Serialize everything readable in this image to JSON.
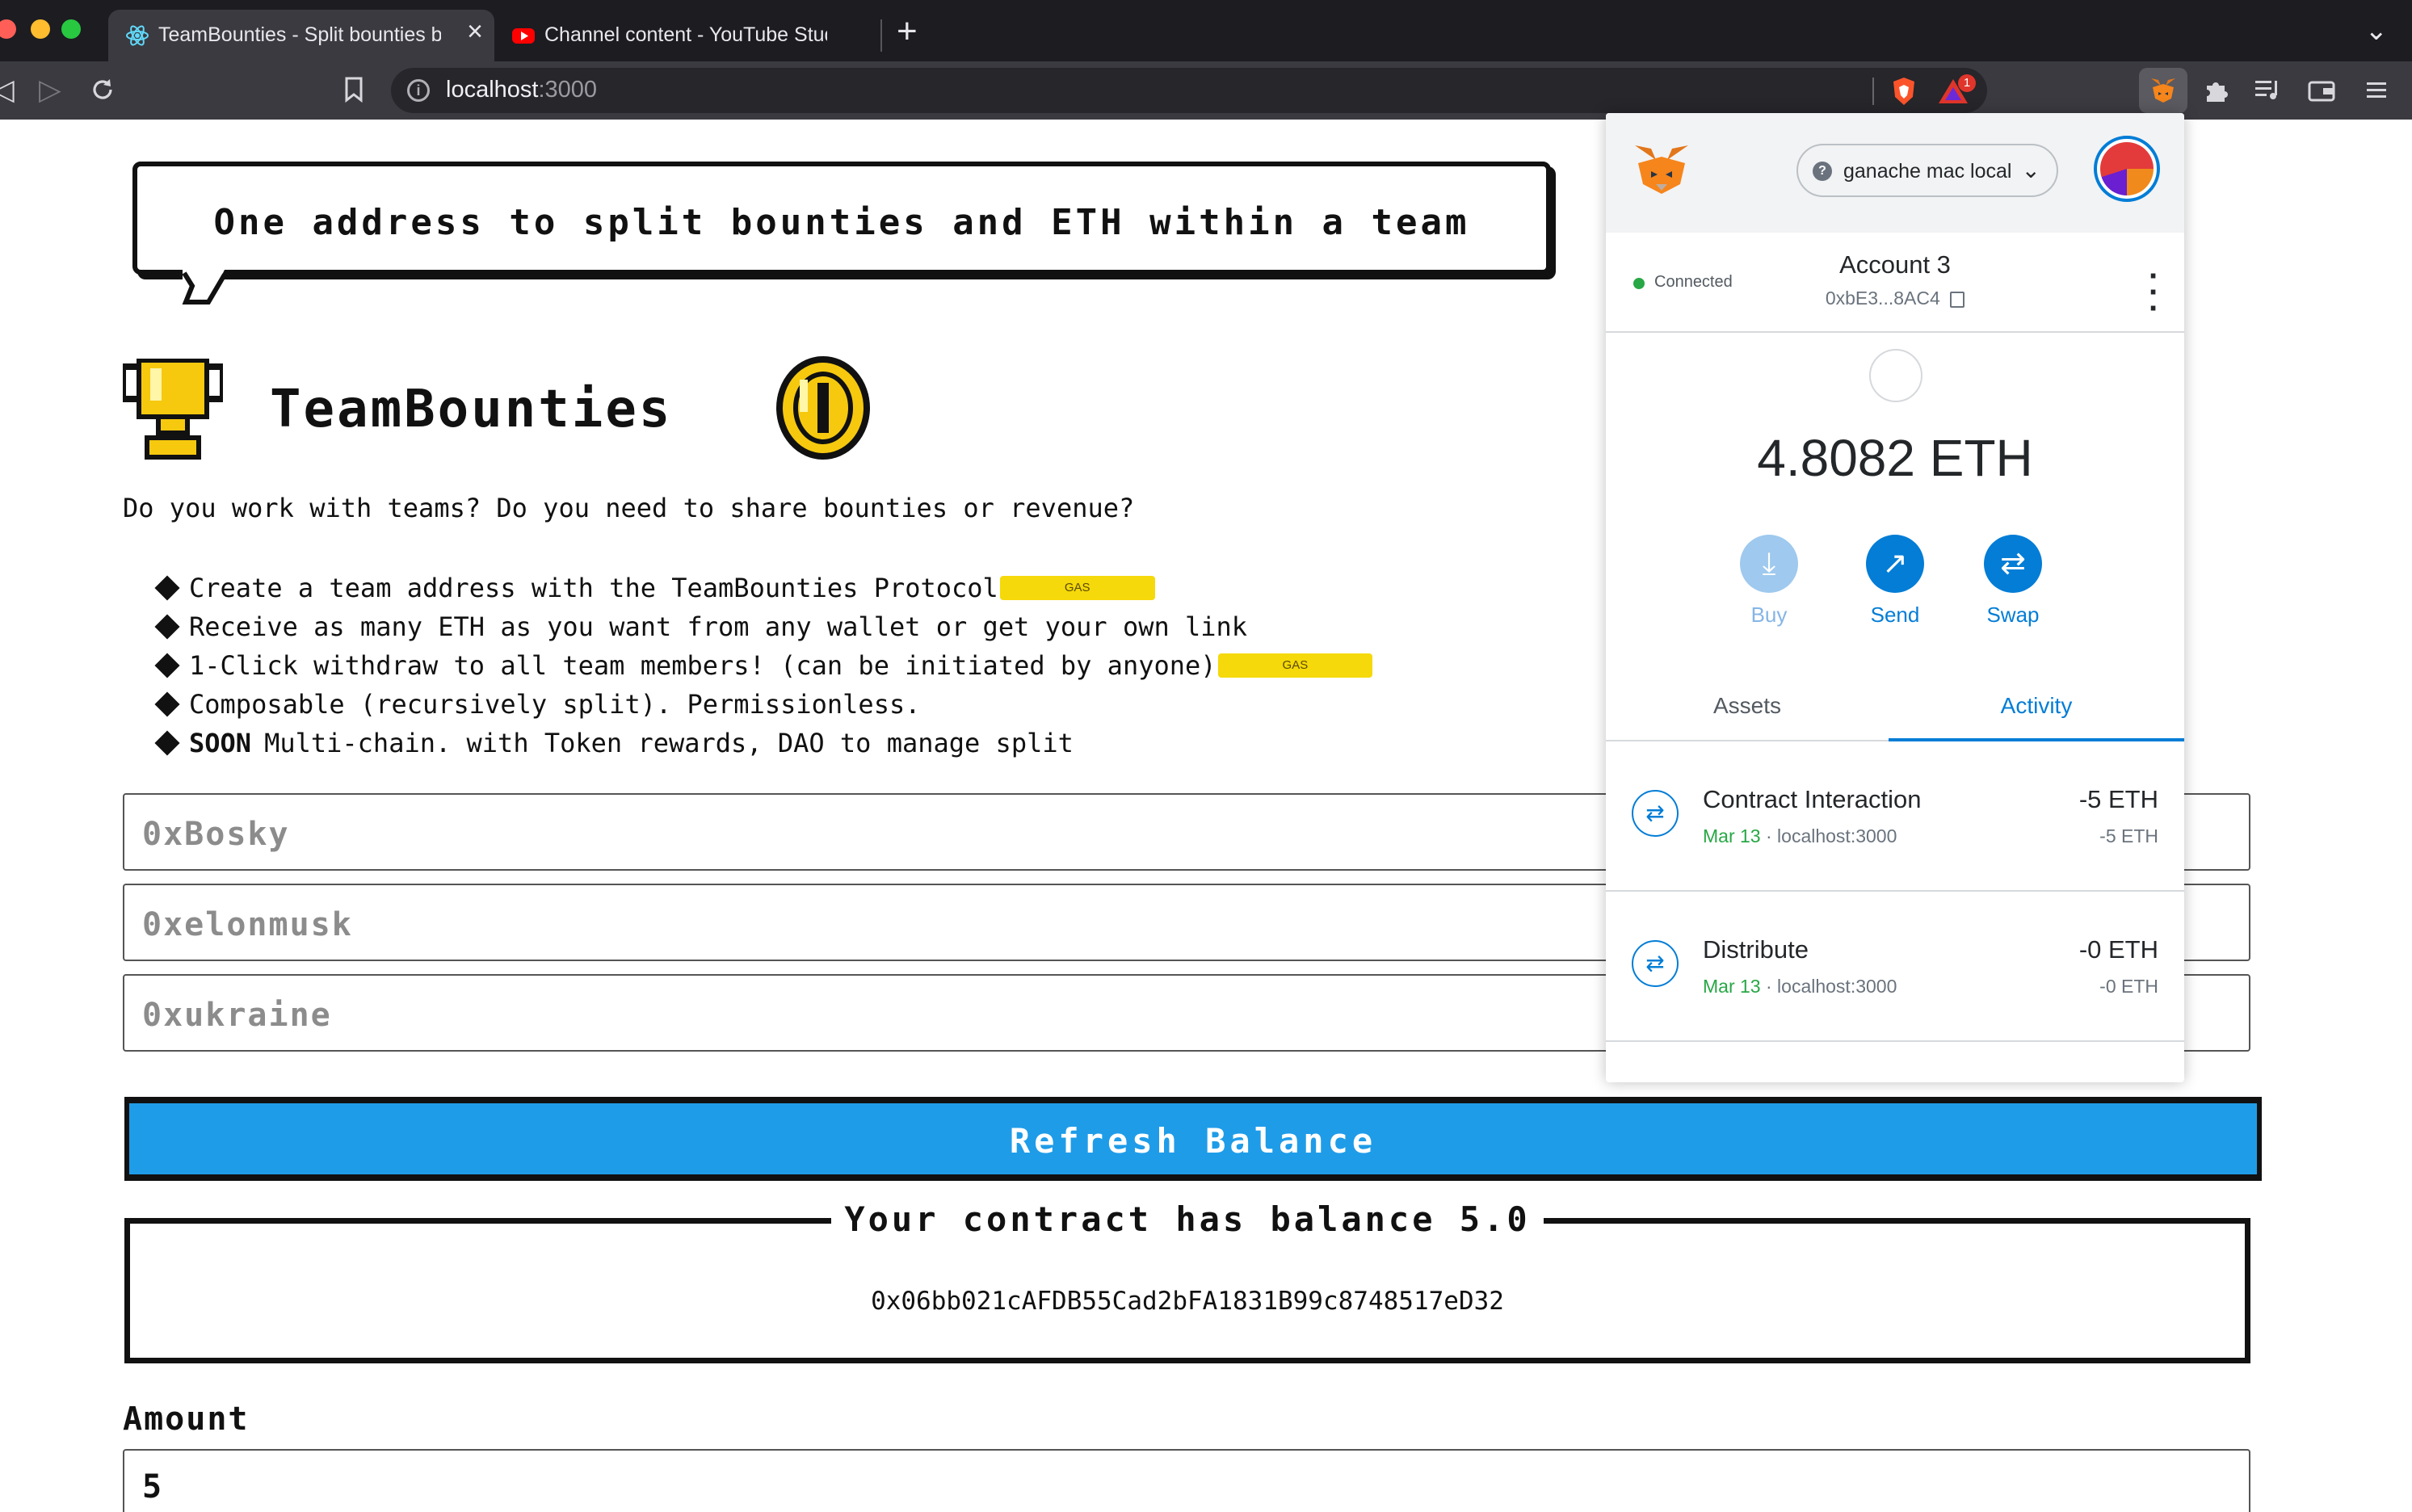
{
  "browser": {
    "tabs": [
      {
        "title": "TeamBounties - Split bounties b",
        "active": true
      },
      {
        "title": "Channel content - YouTube Studio",
        "active": false
      }
    ],
    "url_host": "localhost",
    "url_port": ":3000",
    "brave_badge_count": "1"
  },
  "page": {
    "speech_bubble": "One address to split bounties and ETH within a team",
    "brand": "TeamBounties",
    "lead": "Do you work with teams? Do you need to share bounties or revenue?",
    "features": [
      {
        "text": "Create a team address with the TeamBounties Protocol",
        "gas": "GAS"
      },
      {
        "text": "Receive as many ETH as you want from any wallet or get your own link"
      },
      {
        "text": "1-Click withdraw to all team members! (can be initiated by anyone)",
        "gas": "GAS"
      },
      {
        "text": "Composable (recursively split). Permissionless."
      },
      {
        "bold": "SOON",
        "text": "Multi-chain. with Token rewards, DAO to manage split"
      }
    ],
    "team_inputs": [
      "0xBosky",
      "0xelonmusk",
      "0xukraine"
    ],
    "refresh_button": "Refresh Balance",
    "balance_title": "Your contract has balance 5.0",
    "contract_address": "0x06bb021cAFDB55Cad2bFA1831B99c8748517eD32",
    "amount_label": "Amount",
    "amount_value": "5"
  },
  "metamask": {
    "network": "ganache mac local",
    "connected_label": "Connected",
    "account_name": "Account 3",
    "account_address": "0xbE3...8AC4",
    "balance": "4.8082 ETH",
    "actions": {
      "buy": "Buy",
      "send": "Send",
      "swap": "Swap"
    },
    "tabs": {
      "assets": "Assets",
      "activity": "Activity"
    },
    "transactions": [
      {
        "title": "Contract Interaction",
        "date": "Mar 13",
        "origin": "localhost:3000",
        "amount": "-5 ETH",
        "amount_sub": "-5 ETH"
      },
      {
        "title": "Distribute",
        "date": "Mar 13",
        "origin": "localhost:3000",
        "amount": "-0 ETH",
        "amount_sub": "-0 ETH"
      }
    ]
  },
  "colors": {
    "accent_blue": "#1f9ce8",
    "metamask_blue": "#037dd6",
    "gas_yellow": "#f5d90a",
    "connected_green": "#28a745"
  }
}
